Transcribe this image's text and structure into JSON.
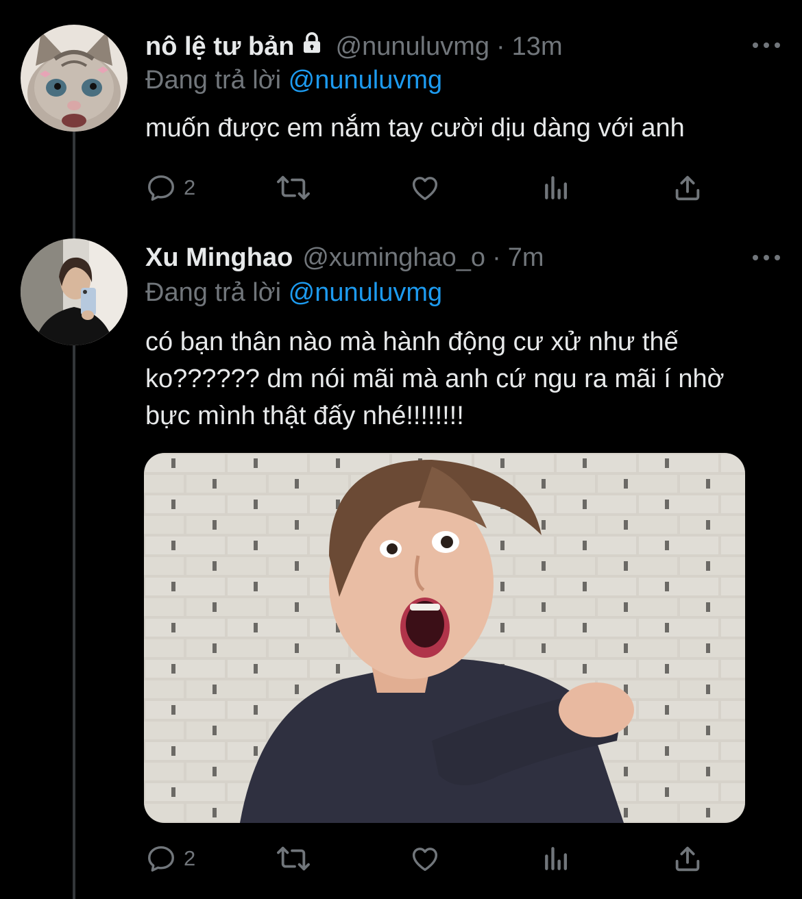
{
  "colors": {
    "background": "#000000",
    "text": "#e7e9ea",
    "secondary": "#71767b",
    "link": "#1d9bf0",
    "thread_line": "#333639"
  },
  "tweets": [
    {
      "display_name": "nô lệ tư bản",
      "protected": true,
      "protected_icon": "lock-icon",
      "handle": "@nunuluvmg",
      "separator": "·",
      "time": "13m",
      "reply_prefix": "Đang trả lời",
      "reply_to": "@nunuluvmg",
      "text": "muốn được em nắm tay cười dịu dàng với anh",
      "avatar": "cat-kitten-avatar",
      "actions": {
        "reply_count": "2",
        "retweet_count": "",
        "like_count": ""
      }
    },
    {
      "display_name": "Xu Minghao",
      "protected": false,
      "handle": "@xuminghao_o",
      "separator": "·",
      "time": "7m",
      "reply_prefix": "Đang trả lời",
      "reply_to": "@nunuluvmg",
      "text": "có bạn thân nào mà hành động cư xử như thế ko?????? dm nói mãi mà anh cứ ngu ra mãi í nhờ bực mình thật đấy nhé!!!!!!!!",
      "avatar": "man-mirror-selfie-avatar",
      "media": "shouting-man-pointing-photo",
      "actions": {
        "reply_count": "2",
        "retweet_count": "",
        "like_count": ""
      }
    }
  ]
}
